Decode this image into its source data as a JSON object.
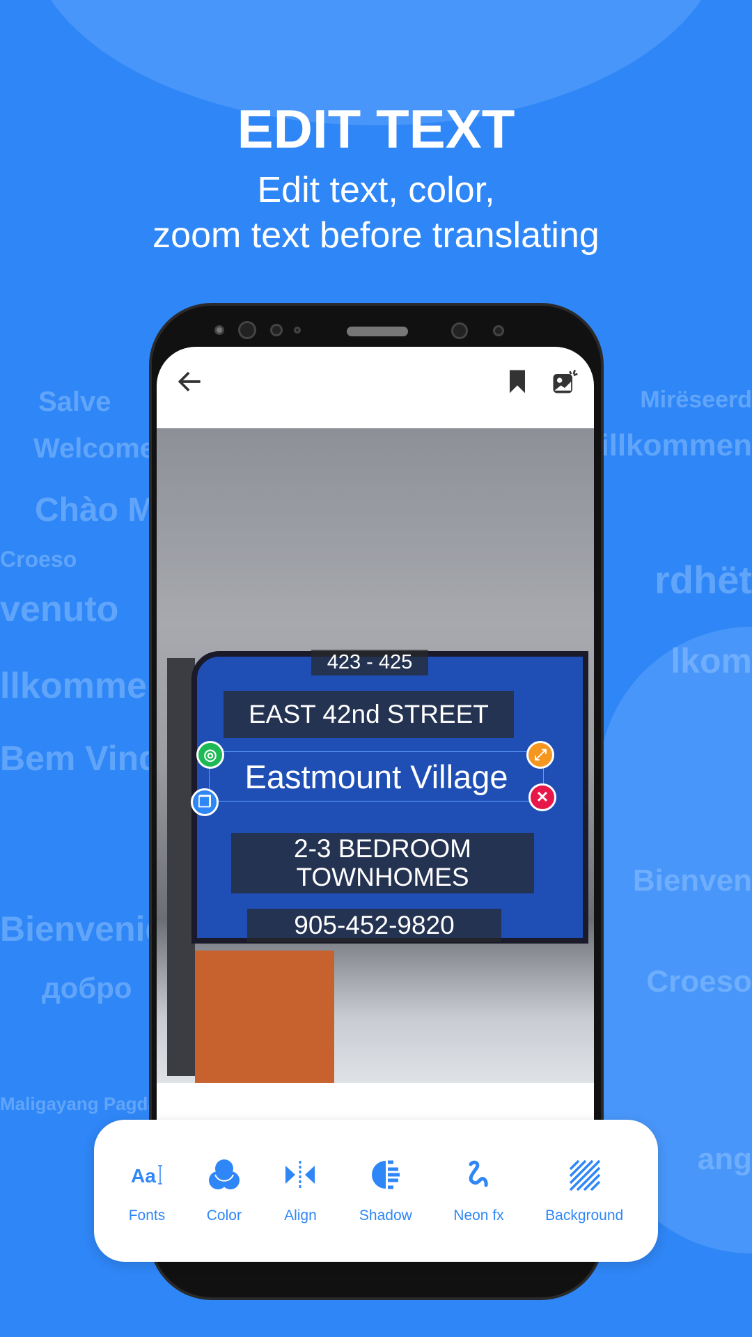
{
  "header": {
    "title": "EDIT TEXT",
    "subtitle_line1": "Edit text, color,",
    "subtitle_line2": "zoom text before translating"
  },
  "background_words": [
    "Salve",
    "Welcome",
    "Chào M",
    "Croeso",
    "venuto",
    "llkommen",
    "Bem Vind",
    "Mirëseerd",
    "illkommen",
    "rdhët",
    "lkom",
    "Bienven",
    "Croeso",
    "Bienvenido",
    "добро",
    "Maligayang Pagda",
    "ang"
  ],
  "app_bar": {
    "back_icon": "arrow-left-icon",
    "bookmark_icon": "bookmark-icon",
    "image_icon": "image-edit-icon"
  },
  "overlays": {
    "line1": "423 - 425",
    "line2": "EAST 42nd STREET",
    "selected": "Eastmount Village",
    "line4": "2-3 BEDROOM TOWNHOMES",
    "line5": "905-452-9820"
  },
  "toolbar": {
    "items": [
      {
        "label": "Fonts",
        "icon": "font-icon"
      },
      {
        "label": "Color",
        "icon": "color-icon"
      },
      {
        "label": "Align",
        "icon": "align-icon"
      },
      {
        "label": "Shadow",
        "icon": "shadow-icon"
      },
      {
        "label": "Neon fx",
        "icon": "neon-icon"
      },
      {
        "label": "Background",
        "icon": "background-pattern-icon"
      }
    ]
  },
  "colors": {
    "brand": "#2f86f6",
    "handle_move": "#1db954",
    "handle_resize": "#f5961e",
    "handle_delete": "#e8174a",
    "handle_copy": "#2f86f6"
  }
}
